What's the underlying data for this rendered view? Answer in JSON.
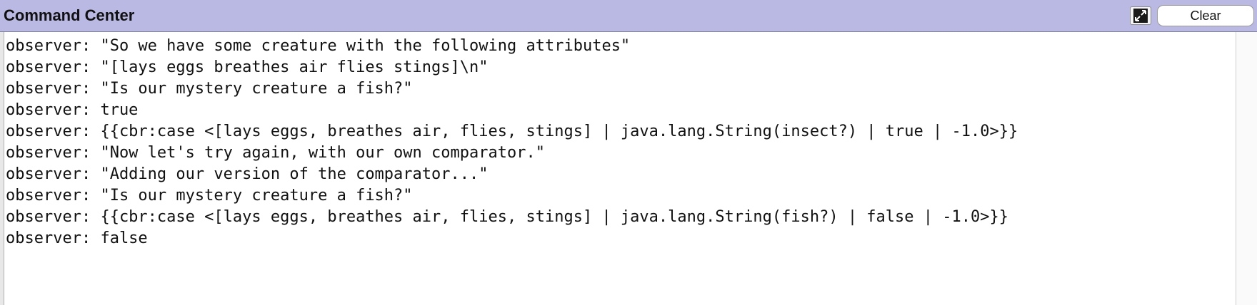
{
  "window": {
    "title": "Command Center",
    "clear_label": "Clear",
    "expand_icon": "expand-arrows-icon"
  },
  "output": {
    "lines": [
      "observer: \"So we have some creature with the following attributes\"",
      "observer: \"[lays eggs breathes air flies stings]\\n\"",
      "observer: \"Is our mystery creature a fish?\"",
      "observer: true",
      "observer: {{cbr:case <[lays eggs, breathes air, flies, stings] | java.lang.String(insect?) | true | -1.0>}}",
      "observer: \"Now let's try again, with our own comparator.\"",
      "observer: \"Adding our version of the comparator...\"",
      "observer: \"Is our mystery creature a fish?\"",
      "observer: {{cbr:case <[lays eggs, breathes air, flies, stings] | java.lang.String(fish?) | false | -1.0>}}",
      "observer: false"
    ]
  },
  "colors": {
    "titlebar": "#b9b9e3",
    "text": "#111111",
    "background": "#ffffff"
  }
}
